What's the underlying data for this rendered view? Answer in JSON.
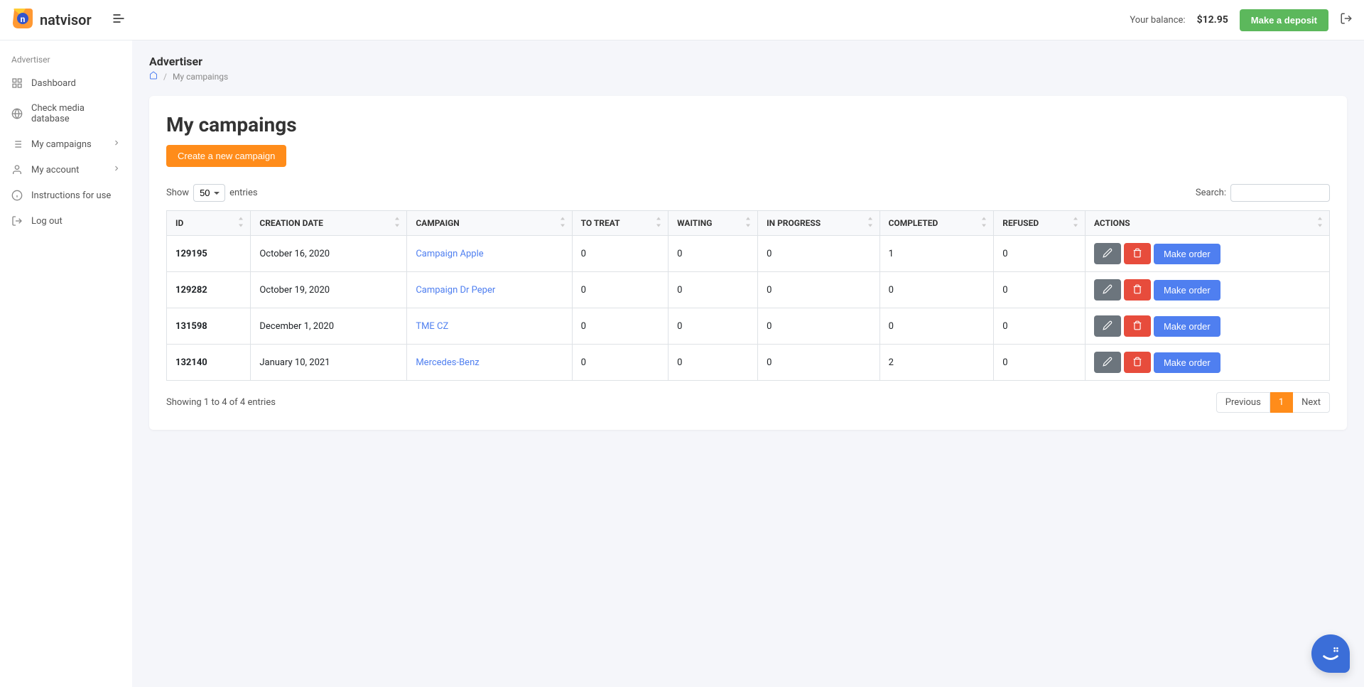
{
  "brand": {
    "name": "natvisor"
  },
  "header": {
    "balance_label": "Your balance:",
    "balance_amount": "$12.95",
    "deposit_label": "Make a deposit"
  },
  "sidebar": {
    "section": "Advertiser",
    "items": [
      {
        "label": "Dashboard"
      },
      {
        "label": "Check media database"
      },
      {
        "label": "My campaigns",
        "expandable": true
      },
      {
        "label": "My account",
        "expandable": true
      },
      {
        "label": "Instructions for use"
      },
      {
        "label": "Log out"
      }
    ]
  },
  "breadcrumb": {
    "title": "Advertiser",
    "current": "My campaings"
  },
  "page": {
    "title": "My campaings",
    "create_button": "Create a new campaign"
  },
  "table": {
    "show_label_pre": "Show",
    "show_label_post": "entries",
    "show_value": "50",
    "search_label": "Search:",
    "columns": [
      "ID",
      "CREATION DATE",
      "CAMPAIGN",
      "TO TREAT",
      "WAITING",
      "IN PROGRESS",
      "COMPLETED",
      "REFUSED",
      "ACTIONS"
    ],
    "rows": [
      {
        "id": "129195",
        "date": "October 16, 2020",
        "campaign": "Campaign Apple",
        "to_treat": "0",
        "waiting": "0",
        "in_progress": "0",
        "completed": "1",
        "refused": "0"
      },
      {
        "id": "129282",
        "date": "October 19, 2020",
        "campaign": "Campaign Dr Peper",
        "to_treat": "0",
        "waiting": "0",
        "in_progress": "0",
        "completed": "0",
        "refused": "0"
      },
      {
        "id": "131598",
        "date": "December 1, 2020",
        "campaign": "TME CZ",
        "to_treat": "0",
        "waiting": "0",
        "in_progress": "0",
        "completed": "0",
        "refused": "0"
      },
      {
        "id": "132140",
        "date": "January 10, 2021",
        "campaign": "Mercedes-Benz",
        "to_treat": "0",
        "waiting": "0",
        "in_progress": "0",
        "completed": "2",
        "refused": "0"
      }
    ],
    "order_button": "Make order",
    "info": "Showing 1 to 4 of 4 entries",
    "pagination": {
      "prev": "Previous",
      "next": "Next",
      "current": "1"
    }
  },
  "icons": {
    "dashboard": "dashboard-icon",
    "globe": "globe-icon",
    "list": "list-icon",
    "user": "user-icon",
    "info": "info-icon",
    "logout": "logout-icon"
  }
}
